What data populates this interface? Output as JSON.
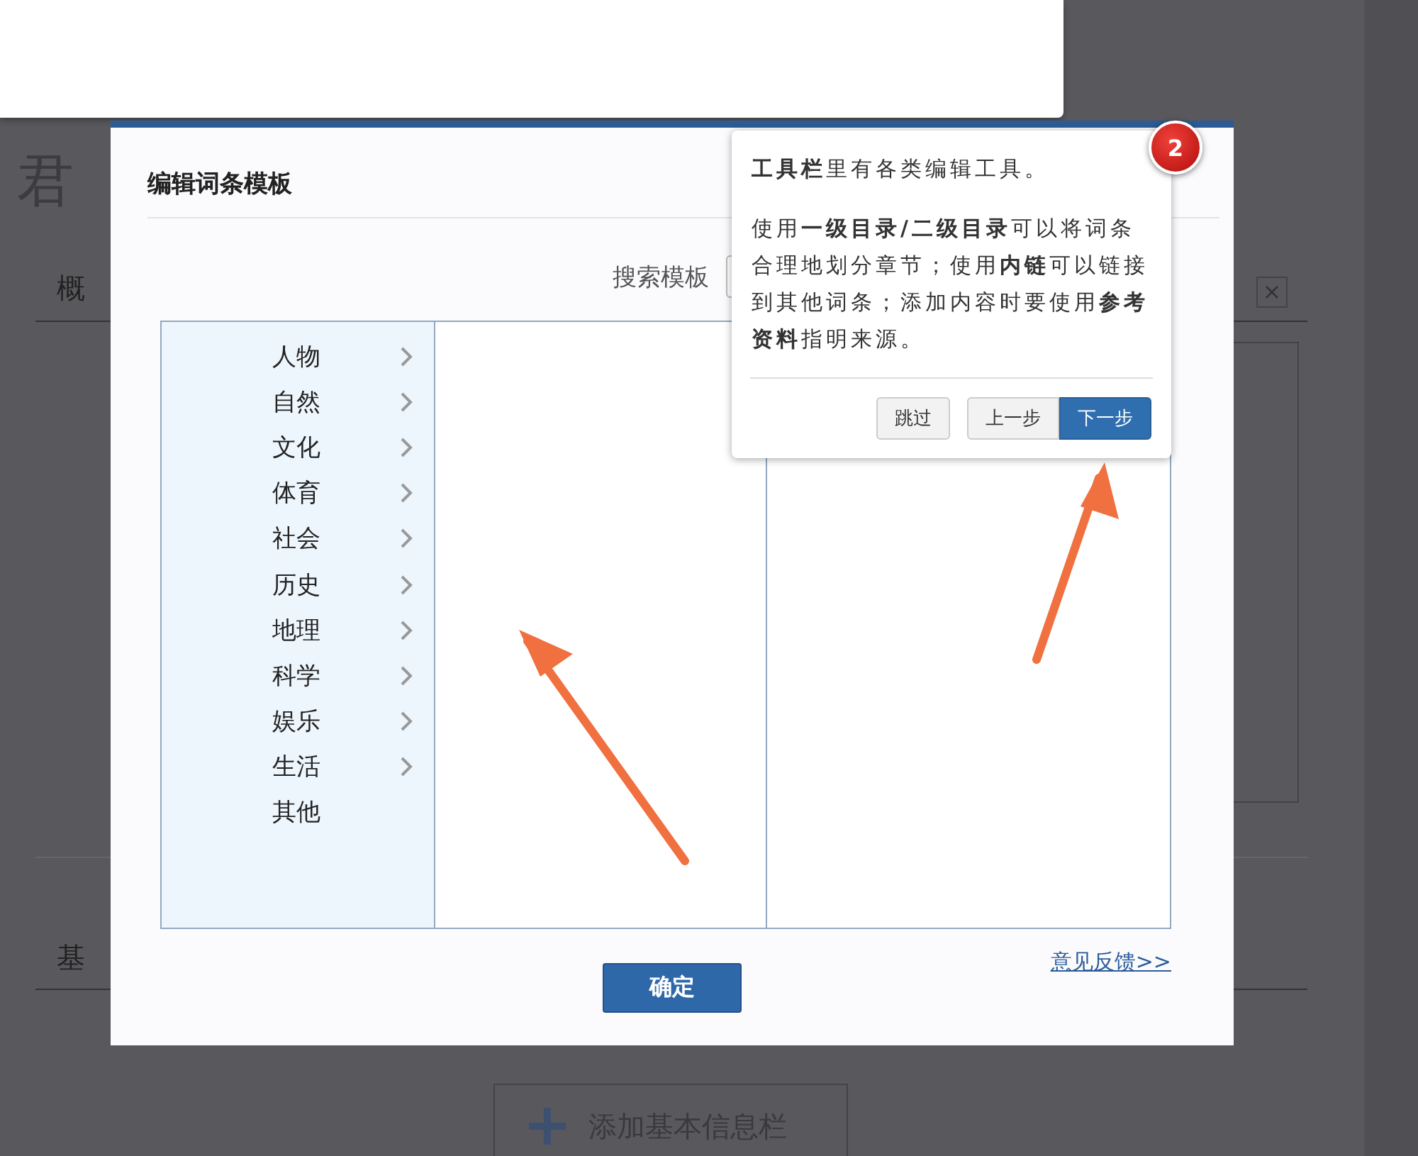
{
  "page": {
    "title": "君",
    "section_1": "概",
    "section_2": "基",
    "close_icon": "×",
    "add_button": "添加基本信息栏"
  },
  "dialog": {
    "title": "编辑词条模板",
    "search_label": "搜索模板",
    "categories": [
      {
        "label": "人物",
        "has_submenu": true
      },
      {
        "label": "自然",
        "has_submenu": true
      },
      {
        "label": "文化",
        "has_submenu": true
      },
      {
        "label": "体育",
        "has_submenu": true
      },
      {
        "label": "社会",
        "has_submenu": true
      },
      {
        "label": "历史",
        "has_submenu": true
      },
      {
        "label": "地理",
        "has_submenu": true
      },
      {
        "label": "科学",
        "has_submenu": true
      },
      {
        "label": "娱乐",
        "has_submenu": true
      },
      {
        "label": "生活",
        "has_submenu": true
      },
      {
        "label": "其他",
        "has_submenu": false
      }
    ],
    "feedback_link": "意见反馈>>",
    "confirm_button": "确定"
  },
  "tour": {
    "step": "2",
    "paragraphs": [
      "**工具栏**里有各类编辑工具。",
      "使用**一级目录/二级目录**可以将词条合理地划分章节；使用**内链**可以链接到其他词条；添加内容时要使用**参考资料**指明来源。"
    ],
    "buttons": [
      {
        "label": "跳过",
        "kind": "skip",
        "selected": false
      },
      {
        "label": "上一步",
        "kind": "prev",
        "selected": false
      },
      {
        "label": "下一步",
        "kind": "next",
        "selected": true
      }
    ]
  }
}
